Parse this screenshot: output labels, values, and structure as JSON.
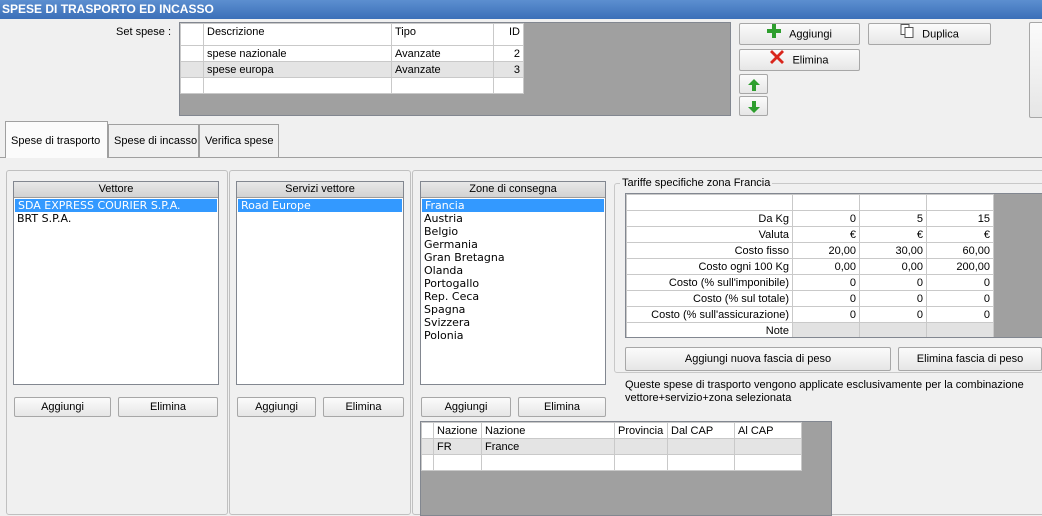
{
  "window": {
    "title": "SPESE DI TRASPORTO ED INCASSO"
  },
  "set_spese": {
    "label": "Set spese :",
    "columns": [
      "Descrizione",
      "Tipo",
      "ID"
    ],
    "rows": [
      {
        "descrizione": "spese nazionale",
        "tipo": "Avanzate",
        "id": "2"
      },
      {
        "descrizione": "spese europa",
        "tipo": "Avanzate",
        "id": "3"
      }
    ]
  },
  "toolbar": {
    "aggiungi": "Aggiungi",
    "duplica": "Duplica",
    "elimina": "Elimina"
  },
  "tabs": [
    "Spese di trasporto",
    "Spese di incasso",
    "Verifica spese"
  ],
  "vettore": {
    "header": "Vettore",
    "items": [
      "SDA EXPRESS COURIER S.P.A.",
      "BRT S.P.A."
    ],
    "add": "Aggiungi",
    "remove": "Elimina"
  },
  "servizi": {
    "header": "Servizi vettore",
    "items": [
      "Road Europe"
    ],
    "add": "Aggiungi",
    "remove": "Elimina"
  },
  "zone": {
    "header": "Zone di consegna",
    "items": [
      "Francia",
      "Austria",
      "Belgio",
      "Germania",
      "Gran Bretagna",
      "Olanda",
      "Portogallo",
      "Rep. Ceca",
      "Spagna",
      "Svizzera",
      "Polonia"
    ],
    "add": "Aggiungi",
    "remove": "Elimina"
  },
  "nazioni": {
    "columns": [
      "Nazione",
      "Nazione",
      "Provincia",
      "Dal CAP",
      "Al CAP"
    ],
    "rows": [
      {
        "code": "FR",
        "name": "France",
        "provincia": "",
        "dal": "",
        "al": ""
      }
    ]
  },
  "tariffe": {
    "title": "Tariffe specifiche zona Francia",
    "rows": [
      {
        "label": "Da Kg",
        "values": [
          "0",
          "5",
          "15"
        ]
      },
      {
        "label": "Valuta",
        "values": [
          "€",
          "€",
          "€"
        ]
      },
      {
        "label": "Costo fisso",
        "values": [
          "20,00",
          "30,00",
          "60,00"
        ]
      },
      {
        "label": "Costo ogni 100 Kg",
        "values": [
          "0,00",
          "0,00",
          "200,00"
        ]
      },
      {
        "label": "Costo (% sull'imponibile)",
        "values": [
          "0",
          "0",
          "0"
        ]
      },
      {
        "label": "Costo (% sul totale)",
        "values": [
          "0",
          "0",
          "0"
        ]
      },
      {
        "label": "Costo (% sull'assicurazione)",
        "values": [
          "0",
          "0",
          "0"
        ]
      },
      {
        "label": "Note",
        "values": [
          "",
          "",
          ""
        ]
      }
    ],
    "add_fascia": "Aggiungi nuova fascia di peso",
    "remove_fascia": "Elimina fascia di peso",
    "info": "Queste spese di trasporto vengono applicate esclusivamente per la combinazione vettore+servizio+zona selezionata"
  },
  "colors": {
    "title_bar": "#3b6fb8",
    "selection": "#3399ff",
    "add_icon": "#2e9e2e",
    "delete_icon": "#d9261c"
  }
}
